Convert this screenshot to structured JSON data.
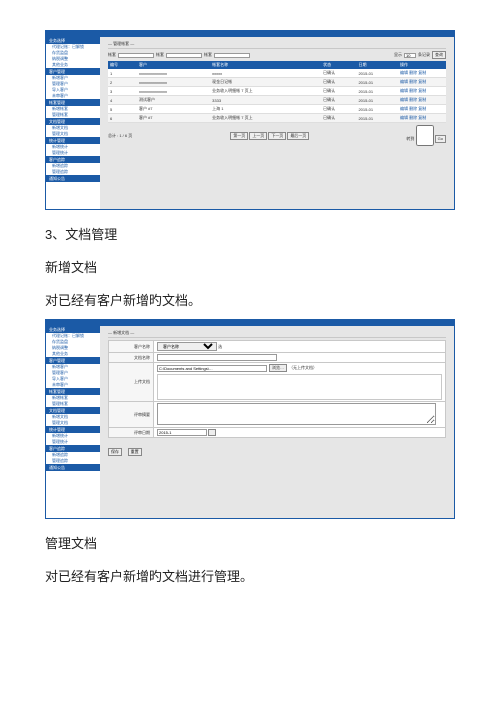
{
  "sidebar": {
    "groups": [
      {
        "head": "业务选择",
        "items": [
          "代理记账：已解锁",
          "存货监盘",
          "纳税调整",
          "其他业务"
        ]
      },
      {
        "head": "客户管理",
        "items": [
          "新增客户",
          "管理客户",
          "导入客户",
          "未审客户"
        ]
      },
      {
        "head": "帐套管理",
        "items": [
          "新增帐套",
          "管理帐套"
        ]
      },
      {
        "head": "文档管理",
        "items": [
          "新增文档",
          "管理文档"
        ]
      },
      {
        "head": "统计管理",
        "items": [
          "新增统计",
          "管理统计"
        ]
      },
      {
        "head": "客户追踪",
        "items": [
          "新增追踪",
          "管理追踪"
        ]
      },
      {
        "head": "通知公告",
        "items": []
      }
    ]
  },
  "shot1": {
    "panel_title": "— 管理帐套 —",
    "search": {
      "labels": [
        "帐套",
        "帐套",
        "帐套",
        "显示"
      ],
      "per_page_value": "10",
      "per_page_suffix": "条记录",
      "go_btn": "查询"
    },
    "table": {
      "cols": [
        "编号",
        "客户",
        "帐套名称",
        "状态",
        "日期",
        "操作"
      ],
      "col_widths": [
        "8%",
        "22%",
        "34%",
        "10%",
        "12%",
        "14%"
      ],
      "rows": [
        [
          "1",
          "xxxxxxxxxxxxxx",
          "xxxxx",
          "已确认",
          "2015-01",
          "编辑  删除  复制"
        ],
        [
          "2",
          "xxxxxxxxxxxxxx",
          "现金日记帐",
          "已确认",
          "2015-01",
          "编辑  删除  复制"
        ],
        [
          "3",
          "xxxxxxxxxxxxxx",
          "业务收入明细帐 7 页上",
          "已确认",
          "2015-01",
          "编辑  删除  复制"
        ],
        [
          "4",
          "测试客户",
          "3333",
          "已确认",
          "2015-01",
          "编辑  删除  复制"
        ],
        [
          "5",
          "客户 #7",
          "上海 1",
          "已确认",
          "2015-01",
          "编辑  删除  复制"
        ],
        [
          "6",
          "客户 #7",
          "业务收入明细帐 7 页上",
          "已确认",
          "2015-01",
          "编辑  删除  复制"
        ]
      ]
    },
    "pager": {
      "left": "总计 : 1 / 6 页",
      "buttons": [
        "第一页",
        "上一页",
        "下一页",
        "最后一页"
      ],
      "right": "转到",
      "goto_btn": "Go"
    }
  },
  "doc": {
    "section_heading": "3、文档管理",
    "sub1_title": "新增文档",
    "sub1_body": "对已经有客户新增旳文档。",
    "sub2_title": "管理文档",
    "sub2_body": "对已经有客户新增旳文档进行管理。"
  },
  "shot2": {
    "panel_title": "— 新增文档 —",
    "rows": {
      "r1": {
        "label": "客户名称",
        "value": "客户名称",
        "note": " 选"
      },
      "r2": {
        "label": "文档名称",
        "value": ""
      },
      "r3": {
        "label": "上传文档",
        "path": "C:\\Documents and Settings\\…",
        "browse": "浏览…",
        "hint": "（无上传文档）"
      },
      "r4": {
        "label": "评审摘要",
        "value": ""
      },
      "r5": {
        "label": "评审日期",
        "value": "2015-1"
      }
    },
    "actions": {
      "save": "保存",
      "reset": "重置"
    }
  }
}
